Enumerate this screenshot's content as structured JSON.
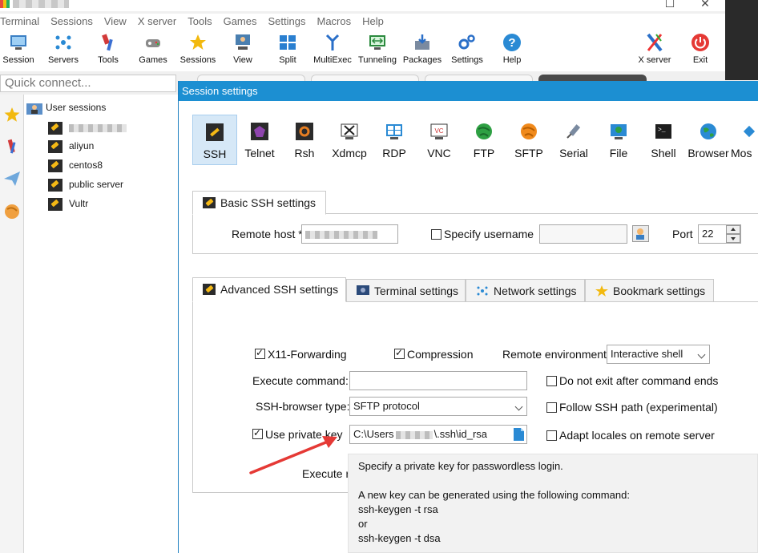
{
  "menubar": [
    "Terminal",
    "Sessions",
    "View",
    "X server",
    "Tools",
    "Games",
    "Settings",
    "Macros",
    "Help"
  ],
  "toolbar": [
    {
      "label": "Session",
      "icon": "session-icon"
    },
    {
      "label": "Servers",
      "icon": "servers-icon"
    },
    {
      "label": "Tools",
      "icon": "tools-icon"
    },
    {
      "label": "Games",
      "icon": "games-icon"
    },
    {
      "label": "Sessions",
      "icon": "sessions-star-icon"
    },
    {
      "label": "View",
      "icon": "view-icon"
    },
    {
      "label": "Split",
      "icon": "split-icon"
    },
    {
      "label": "MultiExec",
      "icon": "multiexec-icon"
    },
    {
      "label": "Tunneling",
      "icon": "tunneling-icon"
    },
    {
      "label": "Packages",
      "icon": "packages-icon"
    },
    {
      "label": "Settings",
      "icon": "settings-gears-icon"
    },
    {
      "label": "Help",
      "icon": "help-icon"
    },
    {
      "label": "X server",
      "icon": "xserver-icon"
    },
    {
      "label": "Exit",
      "icon": "exit-power-icon"
    }
  ],
  "quick_connect": {
    "placeholder": "Quick connect..."
  },
  "sessions_tree": {
    "root": "User sessions",
    "items": [
      "",
      "aliyun",
      "centos8",
      "public server",
      "Vultr"
    ]
  },
  "dialog": {
    "title": "Session settings",
    "protocols": [
      "SSH",
      "Telnet",
      "Rsh",
      "Xdmcp",
      "RDP",
      "VNC",
      "FTP",
      "SFTP",
      "Serial",
      "File",
      "Shell",
      "Browser",
      "Mos"
    ],
    "basic_tab": "Basic SSH settings",
    "remote_host_label": "Remote host *",
    "specify_username_label": "Specify username",
    "port_label": "Port",
    "port_value": "22",
    "tabs": [
      "Advanced SSH settings",
      "Terminal settings",
      "Network settings",
      "Bookmark settings"
    ],
    "x11_label": "X11-Forwarding",
    "compression_label": "Compression",
    "remote_env_label": "Remote environment:",
    "remote_env_value": "Interactive shell",
    "execute_command_label": "Execute command:",
    "do_not_exit_label": "Do not exit after command ends",
    "ssh_browser_label": "SSH-browser type:",
    "ssh_browser_value": "SFTP protocol",
    "follow_ssh_path_label": "Follow SSH path (experimental)",
    "use_private_key_label": "Use private key",
    "private_key_prefix": "C:\\Users",
    "private_key_suffix": "\\.ssh\\id_rsa",
    "adapt_locales_label": "Adapt locales on remote server",
    "execute_macro_label": "Execute r"
  },
  "tooltip": {
    "line1": "Specify a private key for passwordless login.",
    "line2": "A new key can be generated using the following command:",
    "line3": "ssh-keygen -t rsa",
    "line4": "or",
    "line5": "ssh-keygen -t dsa"
  },
  "colors": {
    "title_bar": "#1c8fd2",
    "selected_protocol": "#d6e8f7",
    "arrow": "#e53935"
  }
}
